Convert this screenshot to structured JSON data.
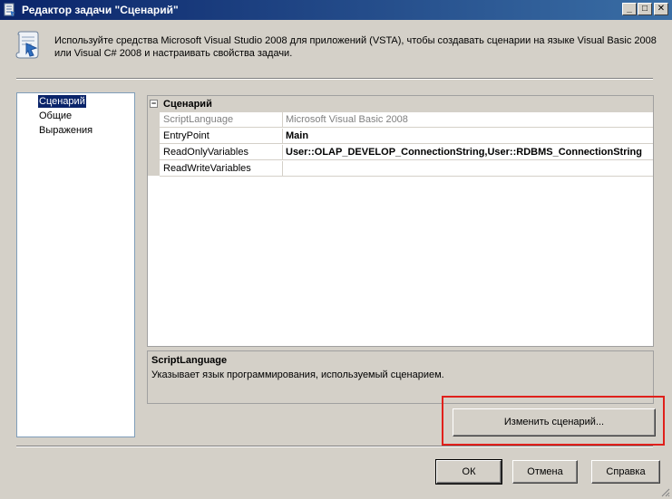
{
  "window": {
    "title": "Редактор задачи \"Сценарий\"",
    "minimize": "_",
    "maximize": "□",
    "close": "✕"
  },
  "header": {
    "description": "Используйте средства Microsoft Visual Studio 2008 для приложений (VSTA), чтобы создавать сценарии на языке Visual Basic 2008 или Visual C# 2008 и настраивать свойства задачи."
  },
  "nav": {
    "items": [
      {
        "label": "Сценарий",
        "selected": true
      },
      {
        "label": "Общие",
        "selected": false
      },
      {
        "label": "Выражения",
        "selected": false
      }
    ]
  },
  "grid": {
    "category": "Сценарий",
    "category_toggle": "−",
    "rows": [
      {
        "name": "ScriptLanguage",
        "value": "Microsoft Visual Basic 2008",
        "disabled": true,
        "bold": false
      },
      {
        "name": "EntryPoint",
        "value": "Main",
        "disabled": false,
        "bold": true
      },
      {
        "name": "ReadOnlyVariables",
        "value": "User::OLAP_DEVELOP_ConnectionString,User::RDBMS_ConnectionString",
        "disabled": false,
        "bold": true
      },
      {
        "name": "ReadWriteVariables",
        "value": "",
        "disabled": false,
        "bold": false
      }
    ]
  },
  "description_panel": {
    "title": "ScriptLanguage",
    "text": "Указывает язык программирования, используемый сценарием."
  },
  "buttons": {
    "edit_script": "Изменить сценарий...",
    "ok": "ОК",
    "cancel": "Отмена",
    "help": "Справка"
  },
  "colors": {
    "highlight_box": "#e0201b",
    "selection": "#0a246a"
  }
}
